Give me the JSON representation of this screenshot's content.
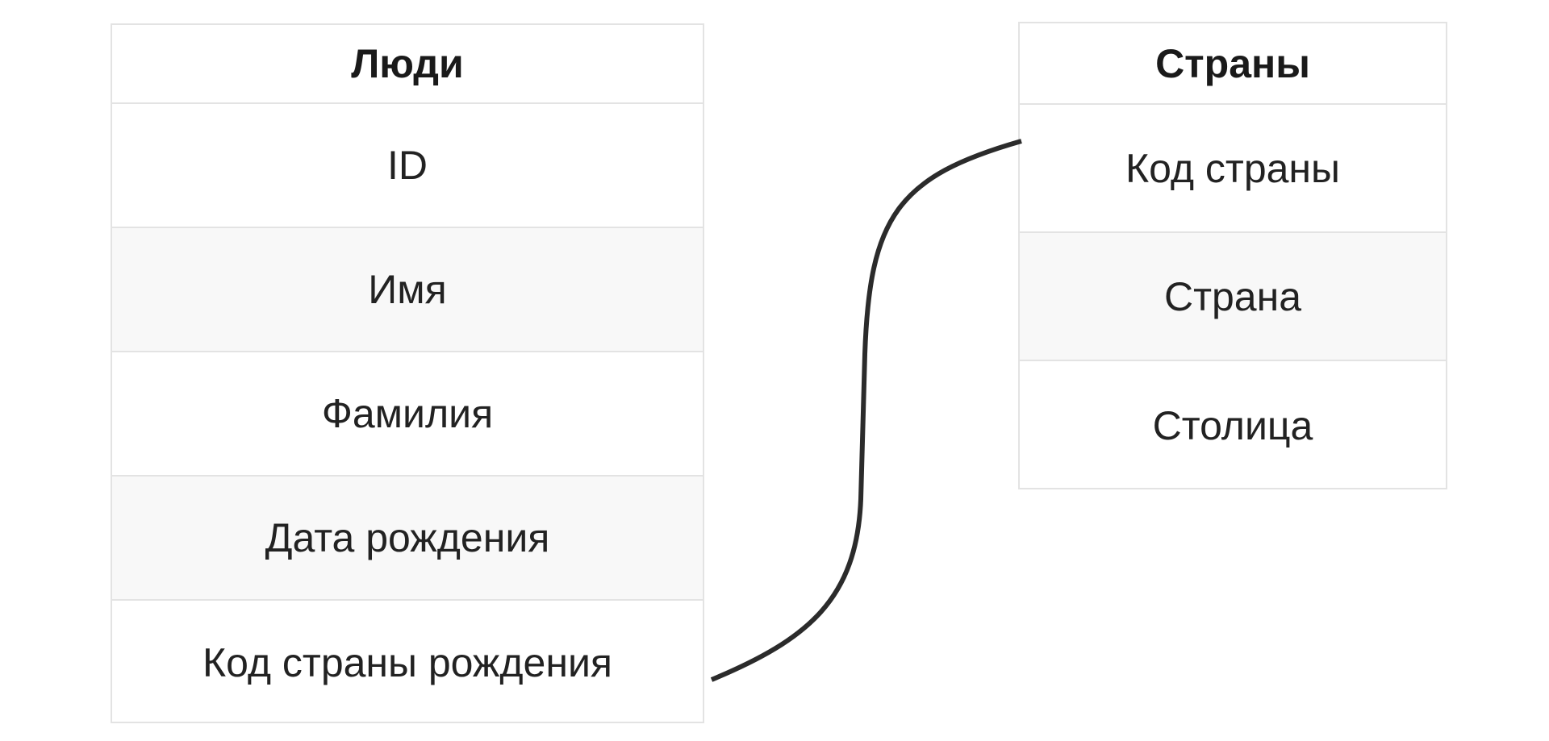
{
  "tables": {
    "people": {
      "title": "Люди",
      "fields": [
        "ID",
        "Имя",
        "Фамилия",
        "Дата рождения",
        "Код страны рождения"
      ]
    },
    "countries": {
      "title": "Страны",
      "fields": [
        "Код страны",
        "Страна",
        "Столица"
      ]
    }
  },
  "relationship": {
    "from_table": "Люди",
    "from_field": "Код страны рождения",
    "to_table": "Страны",
    "to_field": "Код страны"
  },
  "colors": {
    "border": "#e3e3e3",
    "row_alt": "#f8f8f8",
    "connector": "#2b2b2b",
    "text": "#222222"
  }
}
